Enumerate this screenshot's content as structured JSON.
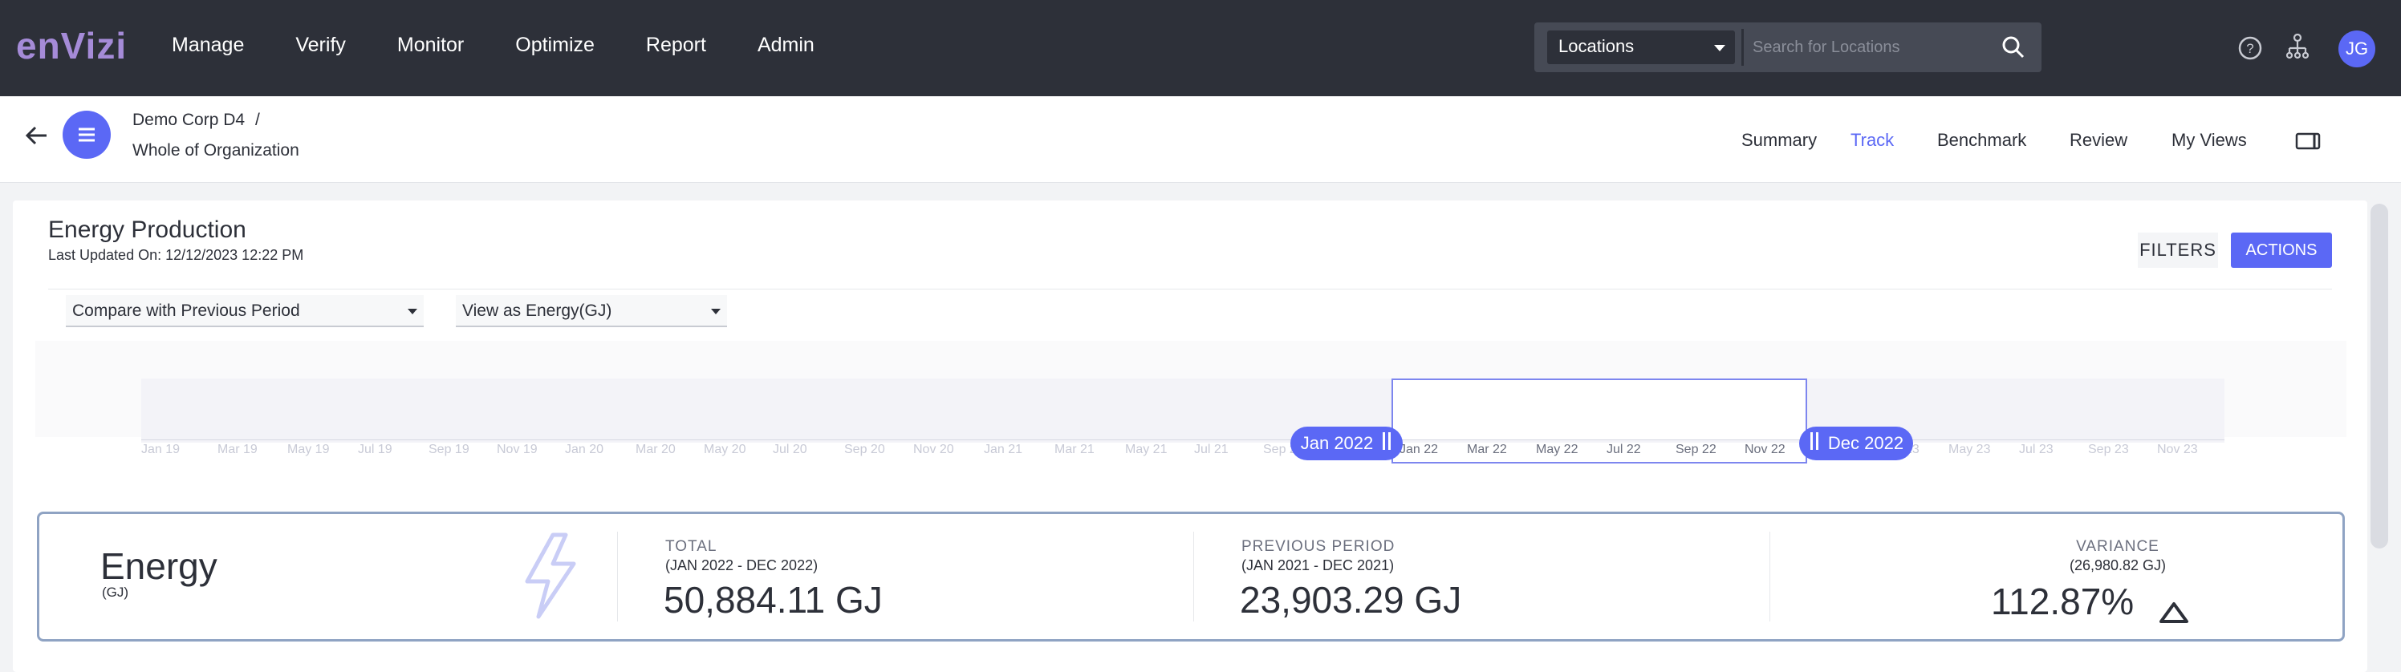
{
  "nav": {
    "logo": "enVizi",
    "menu": [
      "Manage",
      "Verify",
      "Monitor",
      "Optimize",
      "Report",
      "Admin"
    ],
    "location_select": "Locations",
    "search_placeholder": "Search for Locations",
    "avatar_initials": "JG"
  },
  "subheader": {
    "breadcrumb_parent": "Demo Corp D4",
    "breadcrumb_sep": "/",
    "breadcrumb_current": "Whole of Organization",
    "tabs": [
      "Summary",
      "Track",
      "Benchmark",
      "Review",
      "My Views"
    ],
    "active_tab": "Track"
  },
  "report": {
    "title": "Energy Production",
    "last_updated": "Last Updated On: 12/12/2023 12:22 PM",
    "filters_label": "FILTERS",
    "actions_label": "ACTIONS",
    "compare_select": "Compare with Previous Period",
    "view_select": "View as Energy(GJ)"
  },
  "timeline": {
    "ticks": [
      "Jan 19",
      "Mar 19",
      "May 19",
      "Jul 19",
      "Sep 19",
      "Nov 19",
      "Jan 20",
      "Mar 20",
      "May 20",
      "Jul 20",
      "Sep 20",
      "Nov 20",
      "Jan 21",
      "Mar 21",
      "May 21",
      "Jul 21",
      "Sep 21",
      "Jan 22",
      "Mar 22",
      "May 22",
      "Jul 22",
      "Sep 22",
      "Nov 22",
      "Jan 23",
      "Mar 23",
      "May 23",
      "Jul 23",
      "Sep 23",
      "Nov 23"
    ],
    "start_label": "Jan 2022",
    "end_label": "Dec 2022"
  },
  "stats": {
    "metric_title": "Energy",
    "metric_unit": "(GJ)",
    "total_label": "TOTAL",
    "total_period": "(JAN 2022 - DEC 2022)",
    "total_value": "50,884.11 GJ",
    "prev_label": "PREVIOUS PERIOD",
    "prev_period": "(JAN 2021 - DEC 2021)",
    "prev_value": "23,903.29 GJ",
    "variance_label": "VARIANCE",
    "variance_abs": "(26,980.82 GJ)",
    "variance_pct": "112.87%"
  },
  "colors": {
    "accent": "#5b68f5",
    "nav_bg": "#2d3039",
    "logo": "#a58bd8"
  }
}
